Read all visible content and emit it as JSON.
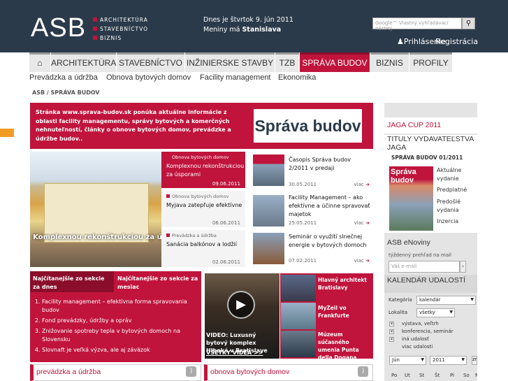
{
  "header": {
    "logo": "ASB",
    "taglines": [
      "ARCHITEKTÚRA",
      "STAVEBNÍCTVO",
      "BIZNIS"
    ],
    "date_line": "Dnes je štvrtok 9. jún 2011",
    "nameday_prefix": "Meniny má ",
    "nameday_name": "Stanislava",
    "search_placeholder": "Google™ Vlastný vyhľadávací nástroj",
    "login": "Prihlásenie",
    "register": "Registrácia"
  },
  "nav": {
    "items": [
      "ARCHITEKTÚRA",
      "STAVEBNÍCTVO",
      "INŽINIERSKE STAVBY",
      "TZB",
      "SPRÁVA BUDOV",
      "BIZNIS",
      "PROFILY"
    ],
    "active": "SPRÁVA BUDOV"
  },
  "subnav": [
    "Prevádzka a údržba",
    "Obnova bytových domov",
    "Facility management",
    "Ekonomika"
  ],
  "breadcrumb": "ASB / SPRÁVA BUDOV",
  "banner": {
    "text": "Stránka www.sprava-budov.sk ponúka aktuálne informácie z oblasti facility managementu, správy bytových a komerčných nehnuteľností, články o obnove bytových domov, prevádzke a údržbe budov..",
    "logo_a": "Správa",
    "logo_b": "budov"
  },
  "feature": {
    "caption": "Komplexnou rekonštrukciou za úsporami"
  },
  "news_left": [
    {
      "category": "Obnova bytových domov",
      "title": "Komplexnou rekonštrukciou za úsporami",
      "date": "09.06.2011"
    },
    {
      "category": "Obnova bytových domov",
      "title": "Myjava zatepľuje efektívne",
      "date": "06.06.2011"
    },
    {
      "category": "Prevádzka a údržba",
      "title": "Sanácia balkónov a lodžií",
      "date": "02.06.2011"
    }
  ],
  "news_right": [
    {
      "title": "Časopis Správa budov 2/2011 v predaji",
      "date": "30.05.2011",
      "more": "viac"
    },
    {
      "title": "Facility Management – ako efektívne a účinne spravovať majetok",
      "date": "25.05.2011",
      "more": "viac"
    },
    {
      "title": "Seminár o využití slnečnej energie v bytových domoch",
      "date": "07.02.2011",
      "more": "viac"
    }
  ],
  "top_tabs": {
    "tab1": "Najčítanejšie zo sekcie za dnes",
    "tab2": "Najčítanejšie zo sekcie za mesiac"
  },
  "top_list": [
    "Facility management – efektívna forma spravovania budov",
    "Fond prevádzky, údržby a opráv",
    "Znižovanie spotreby tepla v bytových domoch na Slovensku",
    "Slovnaft je veľká výzva, ale aj záväzok"
  ],
  "video": {
    "caption": "VIDEO: Luxusný bytový komplex Hlboká v Bratislave",
    "all_link": "VŠETKY VIDEÁ >>",
    "list": [
      "Hlavný architekt Bratislavy",
      "MyZeil vo Frankfurte",
      "Múzeum súčasného umenia Punta della Dogana"
    ]
  },
  "sections": [
    "prevádzka a údržba",
    "obnova bytových domov"
  ],
  "sidebar": {
    "jaga_cup": "JAGA CUP 2011",
    "titles_heading": "TITULY VYDAVATEĽSTVA JAGA",
    "issue": "SPRÁVA BUDOV 01/2011",
    "issue_links": [
      "Aktuálne vydanie",
      "Predplatné",
      "Predošlé vydania",
      "Inzercia"
    ],
    "cover_a": "Správa",
    "cover_b": "budov",
    "enews_title": "ASB eNoviny",
    "enews_desc": "týždenný prehľad na mail",
    "email_placeholder": "Váš e-mail",
    "email_btn": "›",
    "calendar_title": "KALENDÁR UDALOSTÍ",
    "category_label": "Kategória",
    "category_value": "kalendár",
    "locality_label": "Lokalita",
    "locality_value": "všetky",
    "checks": [
      "výstava, veľtrh",
      "konferencia, seminár",
      "iná udalosť",
      "viac udalostí"
    ],
    "month": "Jún",
    "year": "2011",
    "change": "zmeniť",
    "days": [
      "Po",
      "Ut",
      "St",
      "Št",
      "Pi",
      "So",
      "Ne"
    ]
  },
  "colors": {
    "brand_red": "#c0143c",
    "header": "#2b3a4a",
    "accent_orange": "#f29b23"
  }
}
